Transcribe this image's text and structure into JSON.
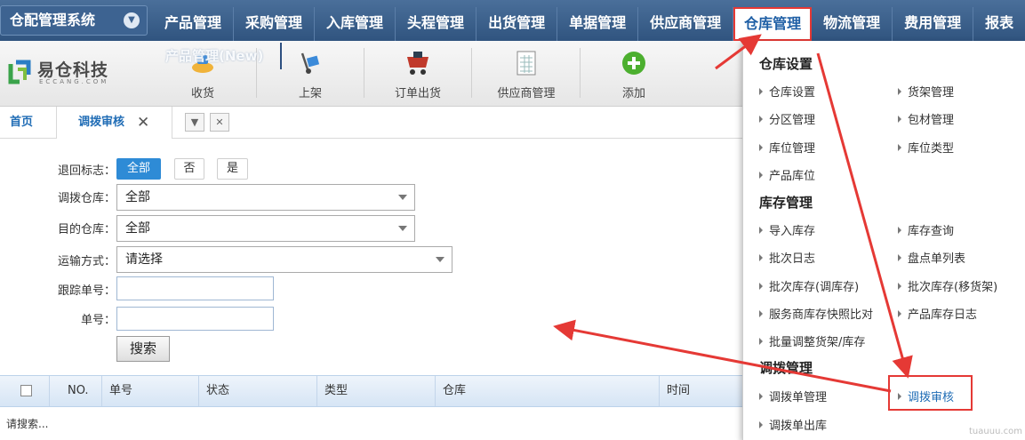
{
  "header": {
    "brand": "仓配管理系统",
    "menu": [
      "产品管理",
      "采购管理",
      "入库管理",
      "头程管理",
      "出货管理",
      "单据管理",
      "供应商管理",
      "仓库管理",
      "物流管理",
      "费用管理",
      "报表"
    ]
  },
  "toolbar": {
    "logo_text": "易仓科技",
    "logo_sub": "ECCANG.COM",
    "overlay_text": "产品管理(New)",
    "buttons": [
      "收货",
      "上架",
      "订单出货",
      "供应商管理",
      "添加"
    ]
  },
  "tabs": {
    "home": "首页",
    "current": "调拨审核",
    "close": "✕",
    "ctrl_menu": "▼",
    "ctrl_close": "✕"
  },
  "form": {
    "return_flag": {
      "label": "退回标志：",
      "options": [
        "全部",
        "否",
        "是"
      ]
    },
    "from_wh": {
      "label": "调拨仓库：",
      "value": "全部"
    },
    "to_wh": {
      "label": "目的仓库：",
      "value": "全部"
    },
    "transport": {
      "label": "运输方式：",
      "value": "请选择"
    },
    "tracking": {
      "label": "跟踪单号：",
      "value": ""
    },
    "order_no": {
      "label": "单号：",
      "value": ""
    },
    "search_label": "搜索"
  },
  "grid": {
    "columns": [
      "NO.",
      "单号",
      "状态",
      "类型",
      "仓库",
      "时间"
    ],
    "empty": "请搜索..."
  },
  "dropdown": {
    "sections": [
      {
        "title": "仓库设置",
        "items": [
          "仓库设置",
          "货架管理",
          "分区管理",
          "包材管理",
          "库位管理",
          "库位类型",
          "产品库位"
        ]
      },
      {
        "title": "库存管理",
        "items": [
          "导入库存",
          "库存查询",
          "批次日志",
          "盘点单列表",
          "批次库存(调库存)",
          "批次库存(移货架)",
          "服务商库存快照比对",
          "产品库存日志",
          "批量调整货架/库存"
        ]
      },
      {
        "title": "调拨管理",
        "items": [
          "调拨单管理",
          "调拨审核",
          "调拨单出库"
        ]
      }
    ]
  },
  "watermark": "tuauuu.com",
  "colors": {
    "nav": "#3d6391",
    "accent": "#2e8bd6",
    "annotation": "#e53935",
    "link": "#1f6cb5"
  }
}
